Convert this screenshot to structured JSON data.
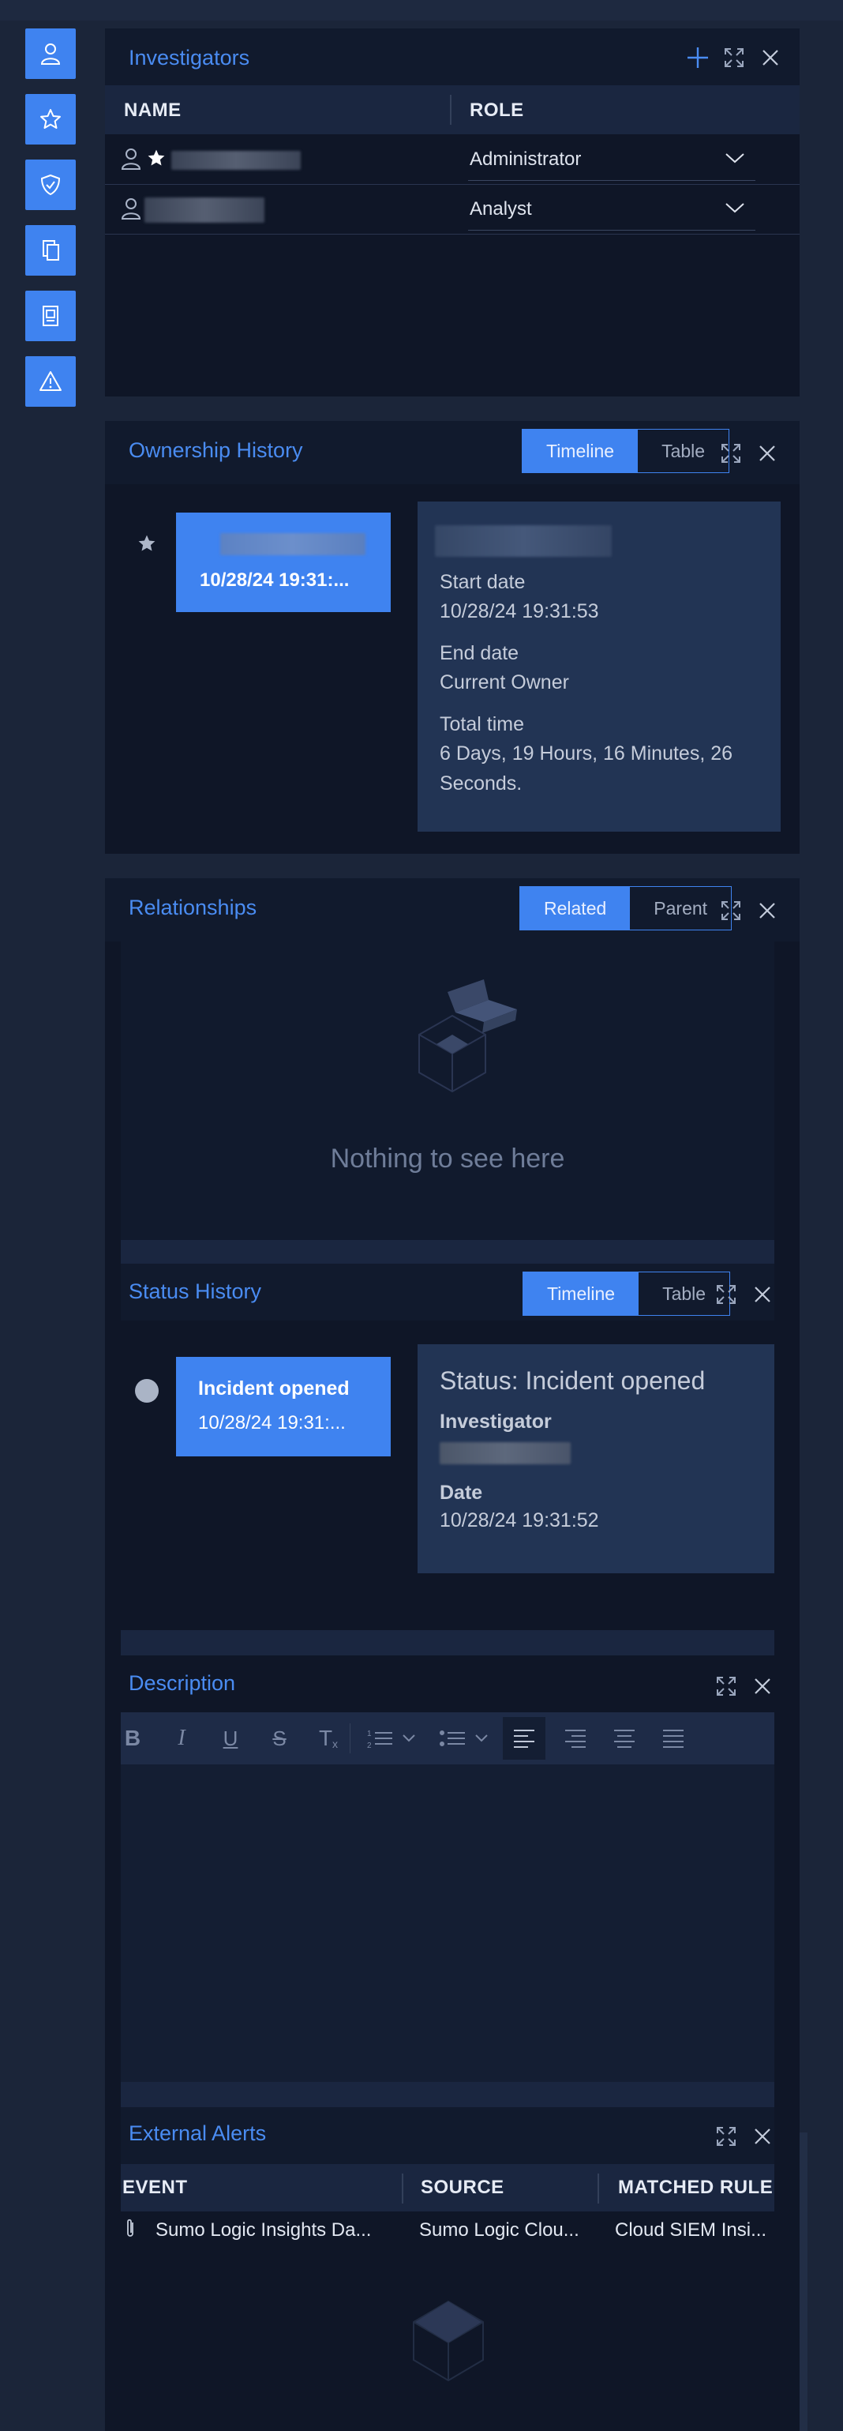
{
  "colors": {
    "accent": "#3f83f0",
    "panel_bg": "#0f1627",
    "header_bg": "#111a2d",
    "detail_bg": "#223454"
  },
  "sidebar": {
    "items": [
      {
        "icon": "person-icon"
      },
      {
        "icon": "star-icon"
      },
      {
        "icon": "shield-check-icon"
      },
      {
        "icon": "documents-icon"
      },
      {
        "icon": "report-icon"
      },
      {
        "icon": "warning-icon"
      }
    ]
  },
  "investigators": {
    "title": "Investigators",
    "columns": [
      "NAME",
      "ROLE"
    ],
    "rows": [
      {
        "owner": true,
        "role": "Administrator"
      },
      {
        "owner": false,
        "role": "Analyst"
      }
    ]
  },
  "ownership": {
    "title": "Ownership History",
    "tabs": [
      "Timeline",
      "Table"
    ],
    "active_tab": "Timeline",
    "card_date": "10/28/24 19:31:...",
    "start_label": "Start date",
    "start_value": "10/28/24 19:31:53",
    "end_label": "End date",
    "end_value": "Current Owner",
    "total_label": "Total time",
    "total_value": "6 Days, 19 Hours, 16 Minutes, 26 Seconds."
  },
  "relationships": {
    "title": "Relationships",
    "tabs": [
      "Related",
      "Parent"
    ],
    "active_tab": "Related",
    "empty_text": "Nothing to see here"
  },
  "status_history": {
    "title": "Status History",
    "tabs": [
      "Timeline",
      "Table"
    ],
    "active_tab": "Timeline",
    "card_title": "Incident opened",
    "card_date": "10/28/24 19:31:...",
    "detail_title": "Status: Incident opened",
    "investigator_label": "Investigator",
    "date_label": "Date",
    "date_value": "10/28/24 19:31:52"
  },
  "description": {
    "title": "Description",
    "toolbar": [
      "bold",
      "italic",
      "underline",
      "strikethrough",
      "clear-format",
      "ordered-list",
      "bullet-list",
      "align-left",
      "align-right",
      "align-center",
      "align-justify"
    ],
    "bold_glyph": "B",
    "italic_glyph": "I",
    "underline_glyph": "U",
    "strike_glyph": "S",
    "clear_glyph": "T"
  },
  "external_alerts": {
    "title": "External Alerts",
    "columns": [
      "EVENT",
      "SOURCE",
      "MATCHED RULE"
    ],
    "rows": [
      {
        "event": "Sumo Logic Insights Da...",
        "source": "Sumo Logic Clou...",
        "rule": "Cloud SIEM Insi..."
      }
    ]
  }
}
